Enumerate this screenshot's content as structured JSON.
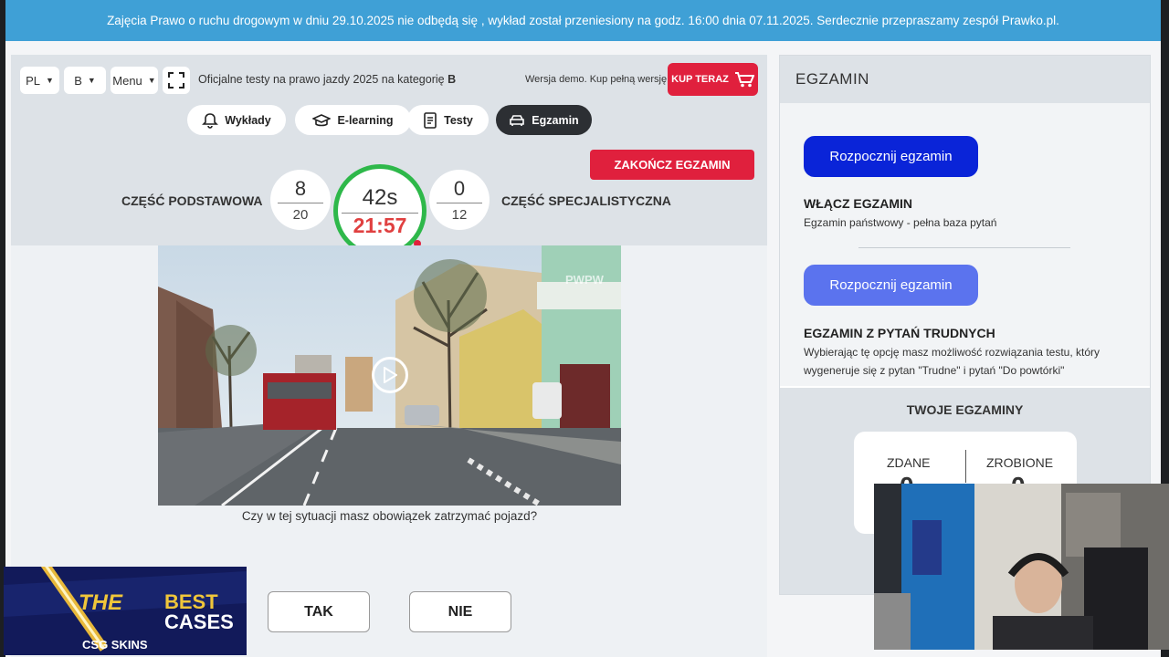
{
  "banner": {
    "text": "Zajęcia Prawo o ruchu drogowym w dniu 29.10.2025 nie odbędą się , wykład został przeniesiony na godz. 16:00 dnia 07.11.2025. Serdecznie przepraszamy zespół Prawko.pl."
  },
  "toolbar": {
    "language": "PL",
    "category": "B",
    "menu_label": "Menu",
    "title_prefix": "Oficjalne testy na prawo jazdy 2025 na kategorię ",
    "title_category": "B",
    "demo_text": "Wersja demo. Kup pełną wersję.",
    "buy_label": "KUP TERAZ"
  },
  "nav": {
    "tabs": [
      {
        "label": "Wykłady",
        "icon": "bell-icon",
        "active": false
      },
      {
        "label": "E-learning",
        "icon": "graduation-cap-icon",
        "active": false
      },
      {
        "label": "Testy",
        "icon": "document-icon",
        "active": false
      },
      {
        "label": "Egzamin",
        "icon": "car-icon",
        "active": true
      }
    ]
  },
  "exam": {
    "end_label": "ZAKOŃCZ EGZAMIN",
    "basic_label": "CZĘŚĆ PODSTAWOWA",
    "basic_done": "8",
    "basic_total": "20",
    "question_timer": "42s",
    "total_timer": "21:57",
    "special_done": "0",
    "special_total": "12",
    "special_label": "CZĘŚĆ SPECJALISTYCZNA",
    "timer_color": "#2eb84a",
    "question": "Czy w tej sytuacji masz obowiązek zatrzymać pojazd?",
    "answer_yes": "TAK",
    "answer_no": "NIE",
    "video_watermark": "PWPW"
  },
  "sidebar": {
    "title": "EGZAMIN",
    "start_label_1": "Rozpocznij egzamin",
    "option1_title": "WŁĄCZ EGZAMIN",
    "option1_desc": "Egzamin państwowy - pełna baza pytań",
    "start_label_2": "Rozpocznij egzamin",
    "option2_title": "EGZAMIN Z PYTAŃ TRUDNYCH",
    "option2_desc": "Wybierając tę opcję masz możliwość rozwiązania testu, który wygeneruje się z pytan \"Trudne\" i pytań \"Do powtórki\"",
    "yours_title": "TWOJE EGZAMINY",
    "passed_label": "ZDANE",
    "passed_value": "0",
    "done_label": "ZROBIONE",
    "done_value": "0"
  },
  "promo": {
    "line1": "THE",
    "line2": "BEST",
    "line3": "CASES",
    "brand": "CSG SKINS"
  },
  "colors": {
    "banner": "#3fa0d6",
    "danger": "#e0203d",
    "primary": "#0a24d8",
    "primary_light": "#5b73ee"
  }
}
